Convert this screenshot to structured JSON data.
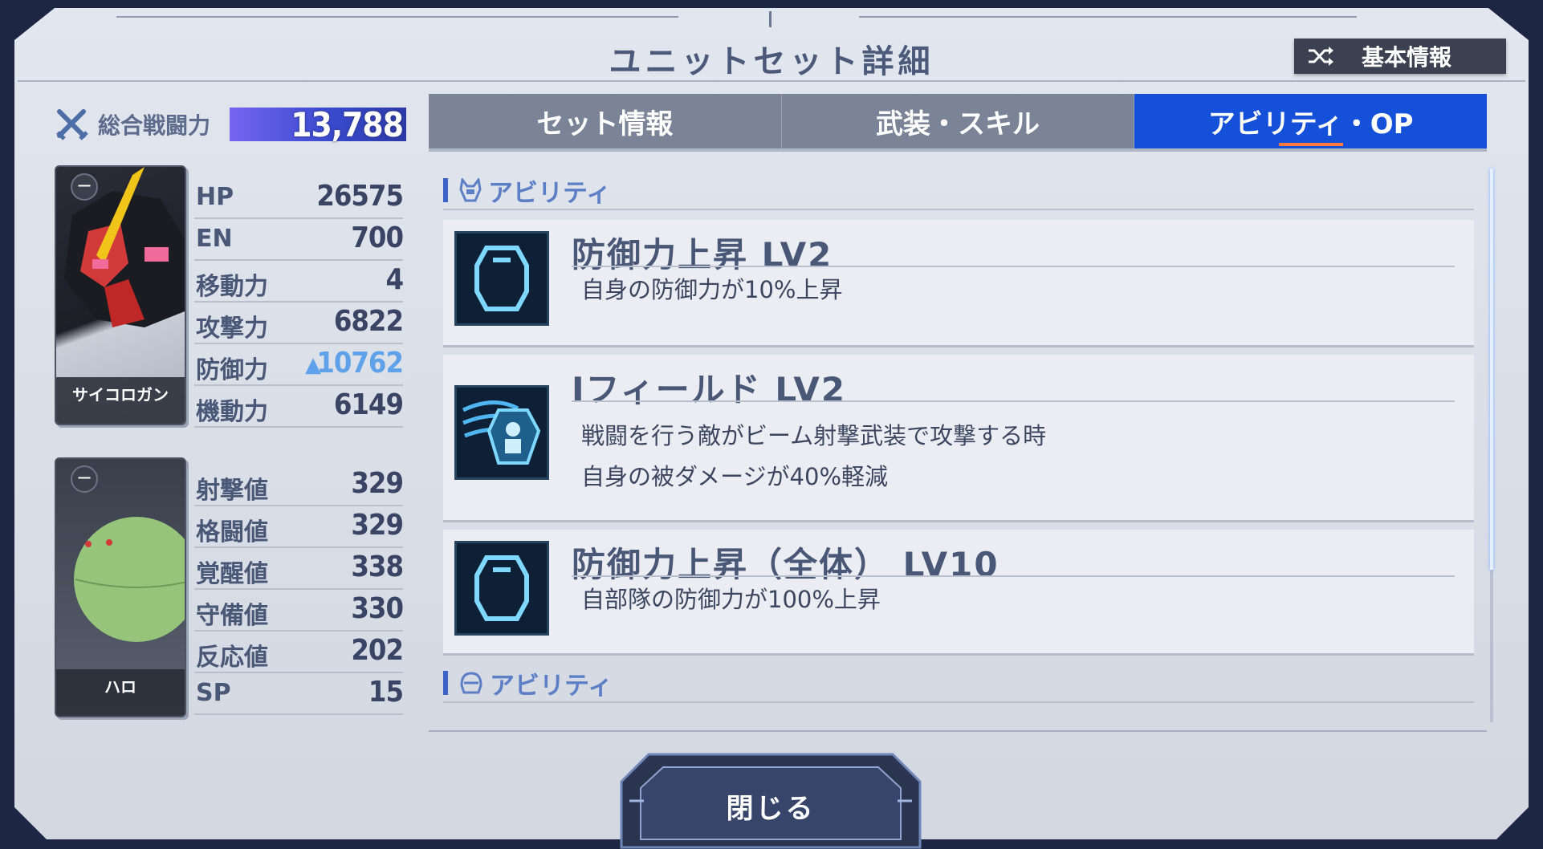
{
  "title": "ユニットセット詳細",
  "basic_info_button": "基本情報",
  "total_power": {
    "label": "総合戦闘力",
    "value": "13,788"
  },
  "units": [
    {
      "name": "サイコロガン"
    },
    {
      "name": "ハロ"
    }
  ],
  "unit_stats": [
    {
      "label": "HP",
      "value": "26575"
    },
    {
      "label": "EN",
      "value": "700"
    },
    {
      "label": "移動力",
      "value": "4"
    },
    {
      "label": "攻撃力",
      "value": "6822"
    },
    {
      "label": "防御力",
      "value": "10762",
      "boosted": true
    },
    {
      "label": "機動力",
      "value": "6149"
    }
  ],
  "pilot_stats": [
    {
      "label": "射撃値",
      "value": "329"
    },
    {
      "label": "格闘値",
      "value": "329"
    },
    {
      "label": "覚醒値",
      "value": "338"
    },
    {
      "label": "守備値",
      "value": "330"
    },
    {
      "label": "反応値",
      "value": "202"
    },
    {
      "label": "SP",
      "value": "15"
    }
  ],
  "tabs": [
    {
      "label": "セット情報",
      "active": false
    },
    {
      "label": "武装・スキル",
      "active": false
    },
    {
      "label": "アビリティ・OP",
      "active": true
    }
  ],
  "sections": [
    {
      "label": "アビリティ",
      "icon": "mobile-suit-icon"
    },
    {
      "label": "アビリティ",
      "icon": "pilot-helmet-icon"
    }
  ],
  "abilities": [
    {
      "name": "防御力上昇 LV2",
      "desc": [
        "自身の防御力が10%上昇"
      ],
      "icon": "shield-icon"
    },
    {
      "name": "Iフィールド LV2",
      "desc": [
        "戦闘を行う敵がビーム射撃武装で攻撃する時",
        "自身の被ダメージが40%軽減"
      ],
      "icon": "i-field-icon"
    },
    {
      "name": "防御力上昇（全体） LV10",
      "desc": [
        "自部隊の防御力が100%上昇"
      ],
      "icon": "shield-icon"
    }
  ],
  "close_button": "閉じる"
}
